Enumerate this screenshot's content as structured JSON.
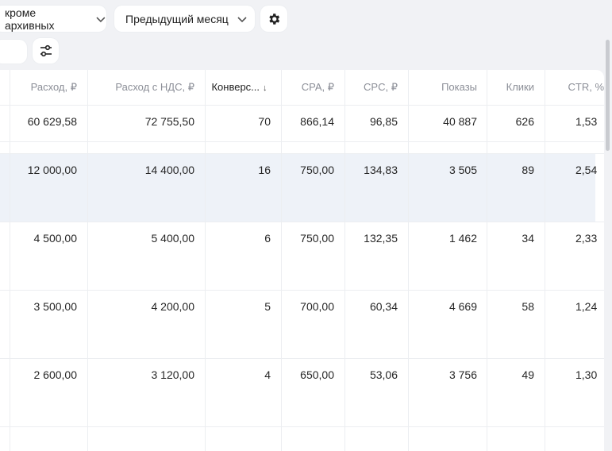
{
  "filters": {
    "archive_label": "кроме архивных",
    "period_label": "Предыдущий месяц"
  },
  "columns": [
    {
      "key": "spend",
      "label": "Расход, ₽"
    },
    {
      "key": "spend_vat",
      "label": "Расход с НДС, ₽"
    },
    {
      "key": "conversions",
      "label": "Конверс...",
      "sort": "↓"
    },
    {
      "key": "cpa",
      "label": "CPA, ₽"
    },
    {
      "key": "cpc",
      "label": "CPC, ₽"
    },
    {
      "key": "impressions",
      "label": "Показы"
    },
    {
      "key": "clicks",
      "label": "Клики"
    },
    {
      "key": "ctr",
      "label": "CTR, %"
    }
  ],
  "rows": [
    [
      "60 629,58",
      "72 755,50",
      "70",
      "866,14",
      "96,85",
      "40 887",
      "626",
      "1,53"
    ],
    [
      "12 000,00",
      "14 400,00",
      "16",
      "750,00",
      "134,83",
      "3 505",
      "89",
      "2,54"
    ],
    [
      "4 500,00",
      "5 400,00",
      "6",
      "750,00",
      "132,35",
      "1 462",
      "34",
      "2,33"
    ],
    [
      "3 500,00",
      "4 200,00",
      "5",
      "700,00",
      "60,34",
      "4 669",
      "58",
      "1,24"
    ],
    [
      "2 600,00",
      "3 120,00",
      "4",
      "650,00",
      "53,06",
      "3 756",
      "49",
      "1,30"
    ]
  ]
}
